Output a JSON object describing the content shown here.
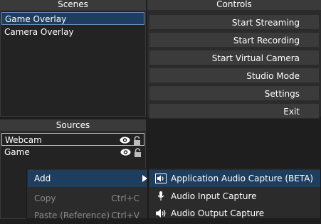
{
  "scenes": {
    "title": "Scenes",
    "items": [
      "Game Overlay",
      "Camera Overlay"
    ]
  },
  "controls": {
    "title": "Controls",
    "buttons": [
      "Start Streaming",
      "Start Recording",
      "Start Virtual Camera",
      "Studio Mode",
      "Settings",
      "Exit"
    ]
  },
  "sources": {
    "title": "Sources",
    "items": [
      "Webcam",
      "Game"
    ]
  },
  "context_menu": {
    "add": "Add",
    "copy": "Copy",
    "copy_shortcut": "Ctrl+C",
    "paste": "Paste (Reference)",
    "paste_shortcut": "Ctrl+V"
  },
  "submenu": {
    "items": [
      "Application Audio Capture (BETA)",
      "Audio Input Capture",
      "Audio Output Capture"
    ]
  },
  "icons": {
    "visibility": "eye-icon",
    "lock": "lock-icon",
    "arrow": "chevron-right-icon",
    "speaker": "speaker-icon",
    "microphone": "microphone-icon"
  },
  "colors": {
    "selection": "#1d3e5f",
    "button": "#3b3b3b",
    "background": "#1e1e1e"
  }
}
